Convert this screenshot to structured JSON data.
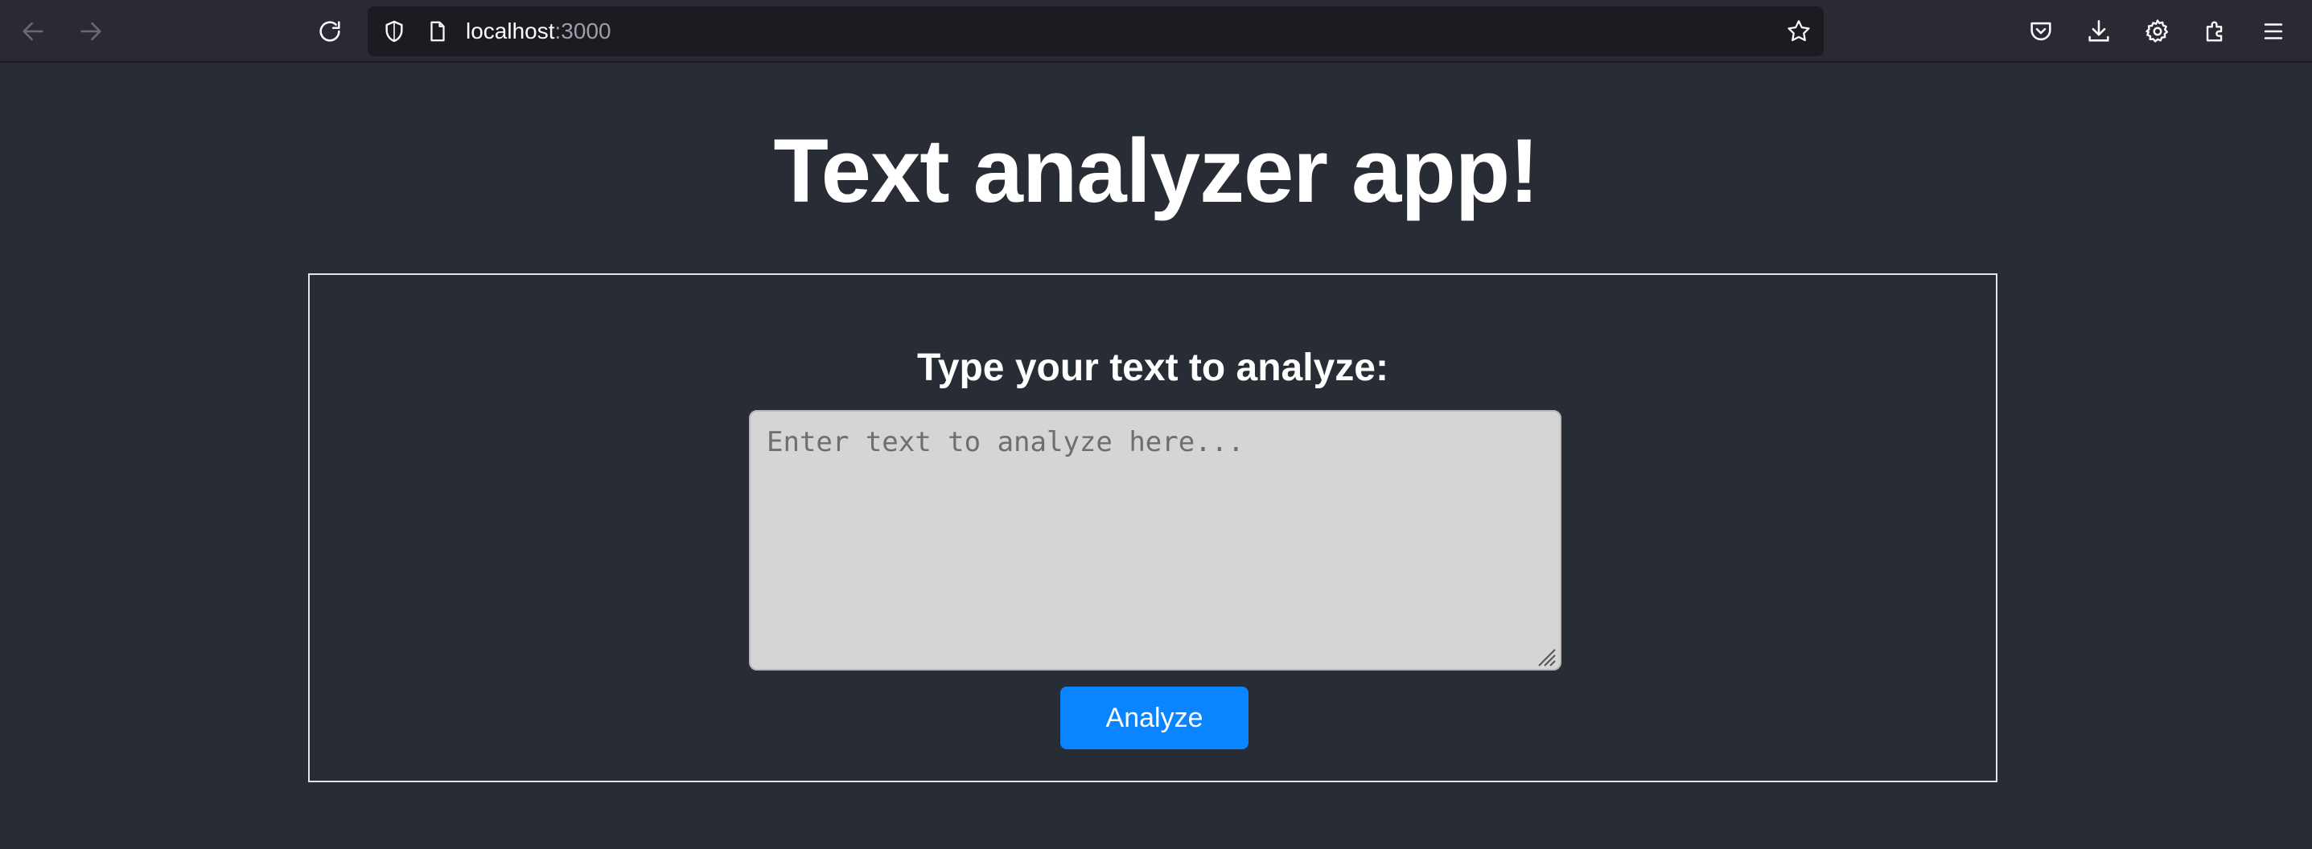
{
  "browser": {
    "url_host": "localhost",
    "url_port": ":3000",
    "colors": {
      "toolbar": "#2b2a33",
      "urlbar": "#1c1b22"
    },
    "icons": [
      "back-arrow-icon",
      "forward-arrow-icon",
      "reload-icon",
      "shield-icon",
      "page-icon",
      "bookmark-star-icon",
      "pocket-icon",
      "download-icon",
      "settings-gear-icon",
      "extensions-icon",
      "menu-icon"
    ]
  },
  "page": {
    "title": "Text analyzer app!",
    "prompt": "Type your text to analyze:",
    "textarea": {
      "value": "",
      "placeholder": "Enter text to analyze here..."
    },
    "analyze_button": "Analyze",
    "colors": {
      "background": "#282c35",
      "button": "#0a84ff",
      "textarea": "#d5d5d5"
    }
  }
}
